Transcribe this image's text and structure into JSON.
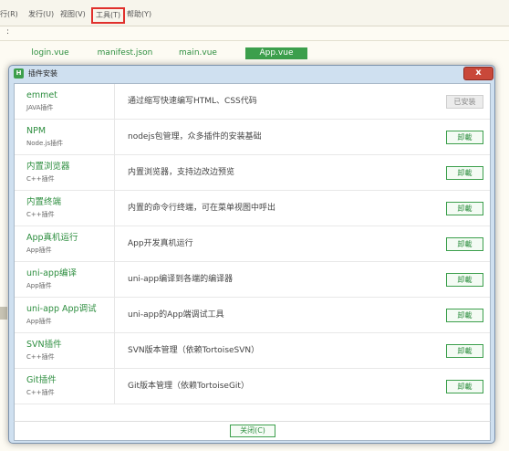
{
  "menubar": {
    "items": [
      "行(R)",
      "发行(U)",
      "视图(V)",
      "工具(T)",
      "帮助(Y)"
    ]
  },
  "toolbar": {
    "mark": ":"
  },
  "tabs": [
    {
      "label": "login.vue"
    },
    {
      "label": "manifest.json"
    },
    {
      "label": "main.vue"
    },
    {
      "label": "App.vue",
      "active": true
    }
  ],
  "dialog": {
    "app_icon": "H",
    "title": "插件安装",
    "close_symbol": "x",
    "plugins": [
      {
        "name": "emmet",
        "type": "JAVA插件",
        "desc": "通过缩写快速编写HTML、CSS代码",
        "button": "已安装",
        "installed": true
      },
      {
        "name": "NPM",
        "type": "Node.js插件",
        "desc": "nodejs包管理，众多插件的安装基础",
        "button": "卸載"
      },
      {
        "name": "内置浏览器",
        "type": "C++插件",
        "desc": "内置浏览器，支持边改边预览",
        "button": "卸載"
      },
      {
        "name": "内置终端",
        "type": "C++插件",
        "desc": "内置的命令行终端，可在菜单视图中呼出",
        "button": "卸載"
      },
      {
        "name": "App真机运行",
        "type": "App插件",
        "desc": "App开发真机运行",
        "button": "卸載"
      },
      {
        "name": "uni-app编译",
        "type": "App插件",
        "desc": "uni-app编译到各端的编译器",
        "button": "卸載"
      },
      {
        "name": "uni-app App调试",
        "type": "App插件",
        "desc": "uni-app的App端调试工具",
        "button": "卸載"
      },
      {
        "name": "SVN插件",
        "type": "C++插件",
        "desc": "SVN版本管理（依赖TortoiseSVN）",
        "button": "卸載"
      },
      {
        "name": "Git插件",
        "type": "C++插件",
        "desc": "Git版本管理（依赖TortoiseGit）",
        "button": "卸載"
      }
    ],
    "close_button": "关闭(C)"
  },
  "colors": {
    "accent_green": "#3c9f4c",
    "highlight_red": "#e0302c",
    "dialog_frame": "#cfe0f0",
    "close_red": "#c9483a"
  }
}
